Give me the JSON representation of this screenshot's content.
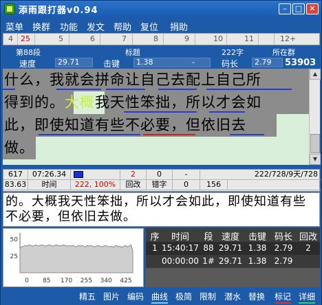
{
  "app": {
    "title": "添雨跟打器v0.94"
  },
  "window_controls": {
    "minimize": "–",
    "maximize": "□",
    "close": "✕"
  },
  "menu": [
    "菜单",
    "换群",
    "功能",
    "发文",
    "帮助",
    "复位",
    "捐助"
  ],
  "ruler": {
    "ticks": [
      "4",
      "25",
      "5",
      "6",
      "7",
      "8",
      "9",
      "10",
      "11",
      "12+"
    ]
  },
  "info": {
    "segment": "第88段",
    "title_label": "标题",
    "char_count": "222字",
    "group_label": "所在群",
    "speed_label": "速度",
    "speed_value": "29.71",
    "keystroke_label": "击键",
    "keystroke_value": "1.38",
    "keystroke_extra": "-",
    "codelen_label": "码长",
    "codelen_value": "2.79",
    "group_value": "53903"
  },
  "source_text": {
    "lines": [
      "什么，我就会拼命让自己去配上自己所",
      "得到的。大概我天性笨拙，所以才会如",
      "此，即使知道有些不必要，但依旧去",
      "做。"
    ],
    "current_char": "大概"
  },
  "status": {
    "r1": [
      "617",
      "07:26.34",
      "",
      "2",
      "0",
      "-",
      "222/728/9天/728"
    ],
    "r2": [
      "83.63",
      "时间",
      "222, 100%",
      "回改",
      "错字",
      "0",
      "156"
    ]
  },
  "typed_text": "的。大概我天性笨拙，所以才会如此，即使知道有些不必要，但依旧去做。",
  "chart_data": {
    "type": "line",
    "x_ticks": [
      "0",
      "85",
      "170",
      "255",
      "340",
      "425"
    ],
    "y_ticks": [
      "50",
      "25"
    ],
    "values": [
      37,
      39,
      40,
      41,
      40,
      42,
      41,
      40,
      41,
      42,
      40,
      41,
      42,
      41,
      40,
      41,
      42,
      41,
      40,
      41,
      42,
      41,
      40,
      41,
      42,
      41,
      40,
      41,
      40,
      41,
      40,
      39,
      41,
      40,
      41,
      40,
      39,
      41,
      40,
      41,
      40,
      39,
      40,
      41,
      40,
      39,
      40,
      41,
      40,
      39,
      40,
      38,
      40,
      41,
      39,
      40,
      38,
      40,
      41,
      39,
      40,
      42,
      33
    ],
    "ylim": [
      0,
      60
    ]
  },
  "history": {
    "headers": [
      "序",
      "时间",
      "段",
      "速度",
      "击键",
      "码长",
      "回改"
    ],
    "rows": [
      [
        "1",
        "15:40:17",
        "88",
        "29.71",
        "1.38",
        "2.79",
        "2"
      ],
      [
        "",
        "00:00:00",
        "1#",
        "29.71",
        "1.38",
        "2.79",
        ""
      ]
    ]
  },
  "bottom_bar": [
    "精五",
    "图片",
    "编码",
    "曲线",
    "极简",
    "限制",
    "潜水",
    "替换",
    "标记",
    "详细"
  ]
}
